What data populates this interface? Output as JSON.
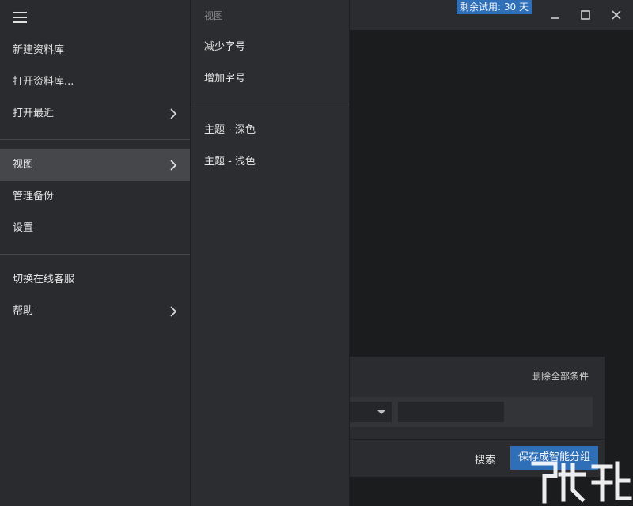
{
  "window": {
    "trial_badge": "剩余试用: 30 天",
    "minimize_icon": "minimize-icon",
    "maximize_icon": "maximize-icon",
    "close_icon": "close-icon"
  },
  "drawer": {
    "menu_icon": "hamburger-menu-icon",
    "items": [
      {
        "label": "新建资料库",
        "has_submenu": false
      },
      {
        "label": "打开资料库...",
        "has_submenu": false
      },
      {
        "label": "打开最近",
        "has_submenu": true
      },
      {
        "label": "视图",
        "has_submenu": true,
        "active": true
      },
      {
        "label": "管理备份",
        "has_submenu": false
      },
      {
        "label": "设置",
        "has_submenu": false
      },
      {
        "label": "切换在线客服",
        "has_submenu": false
      },
      {
        "label": "帮助",
        "has_submenu": true
      }
    ]
  },
  "submenu": {
    "header": "视图",
    "items": [
      {
        "label": "减少字号"
      },
      {
        "label": "增加字号"
      },
      {
        "label": "主题 - 深色"
      },
      {
        "label": "主题 - 浅色"
      }
    ]
  },
  "filter_panel": {
    "delete_all_label": "删除全部条件",
    "search_label": "搜索",
    "save_smart_group_label": "保存成智能分组",
    "select_value": "",
    "input_value": ""
  },
  "colors": {
    "accent": "#2e6fb8",
    "drawer_bg": "#2a2b2e",
    "active_item_bg": "#46474b",
    "content_bg": "#1b1c1e"
  }
}
